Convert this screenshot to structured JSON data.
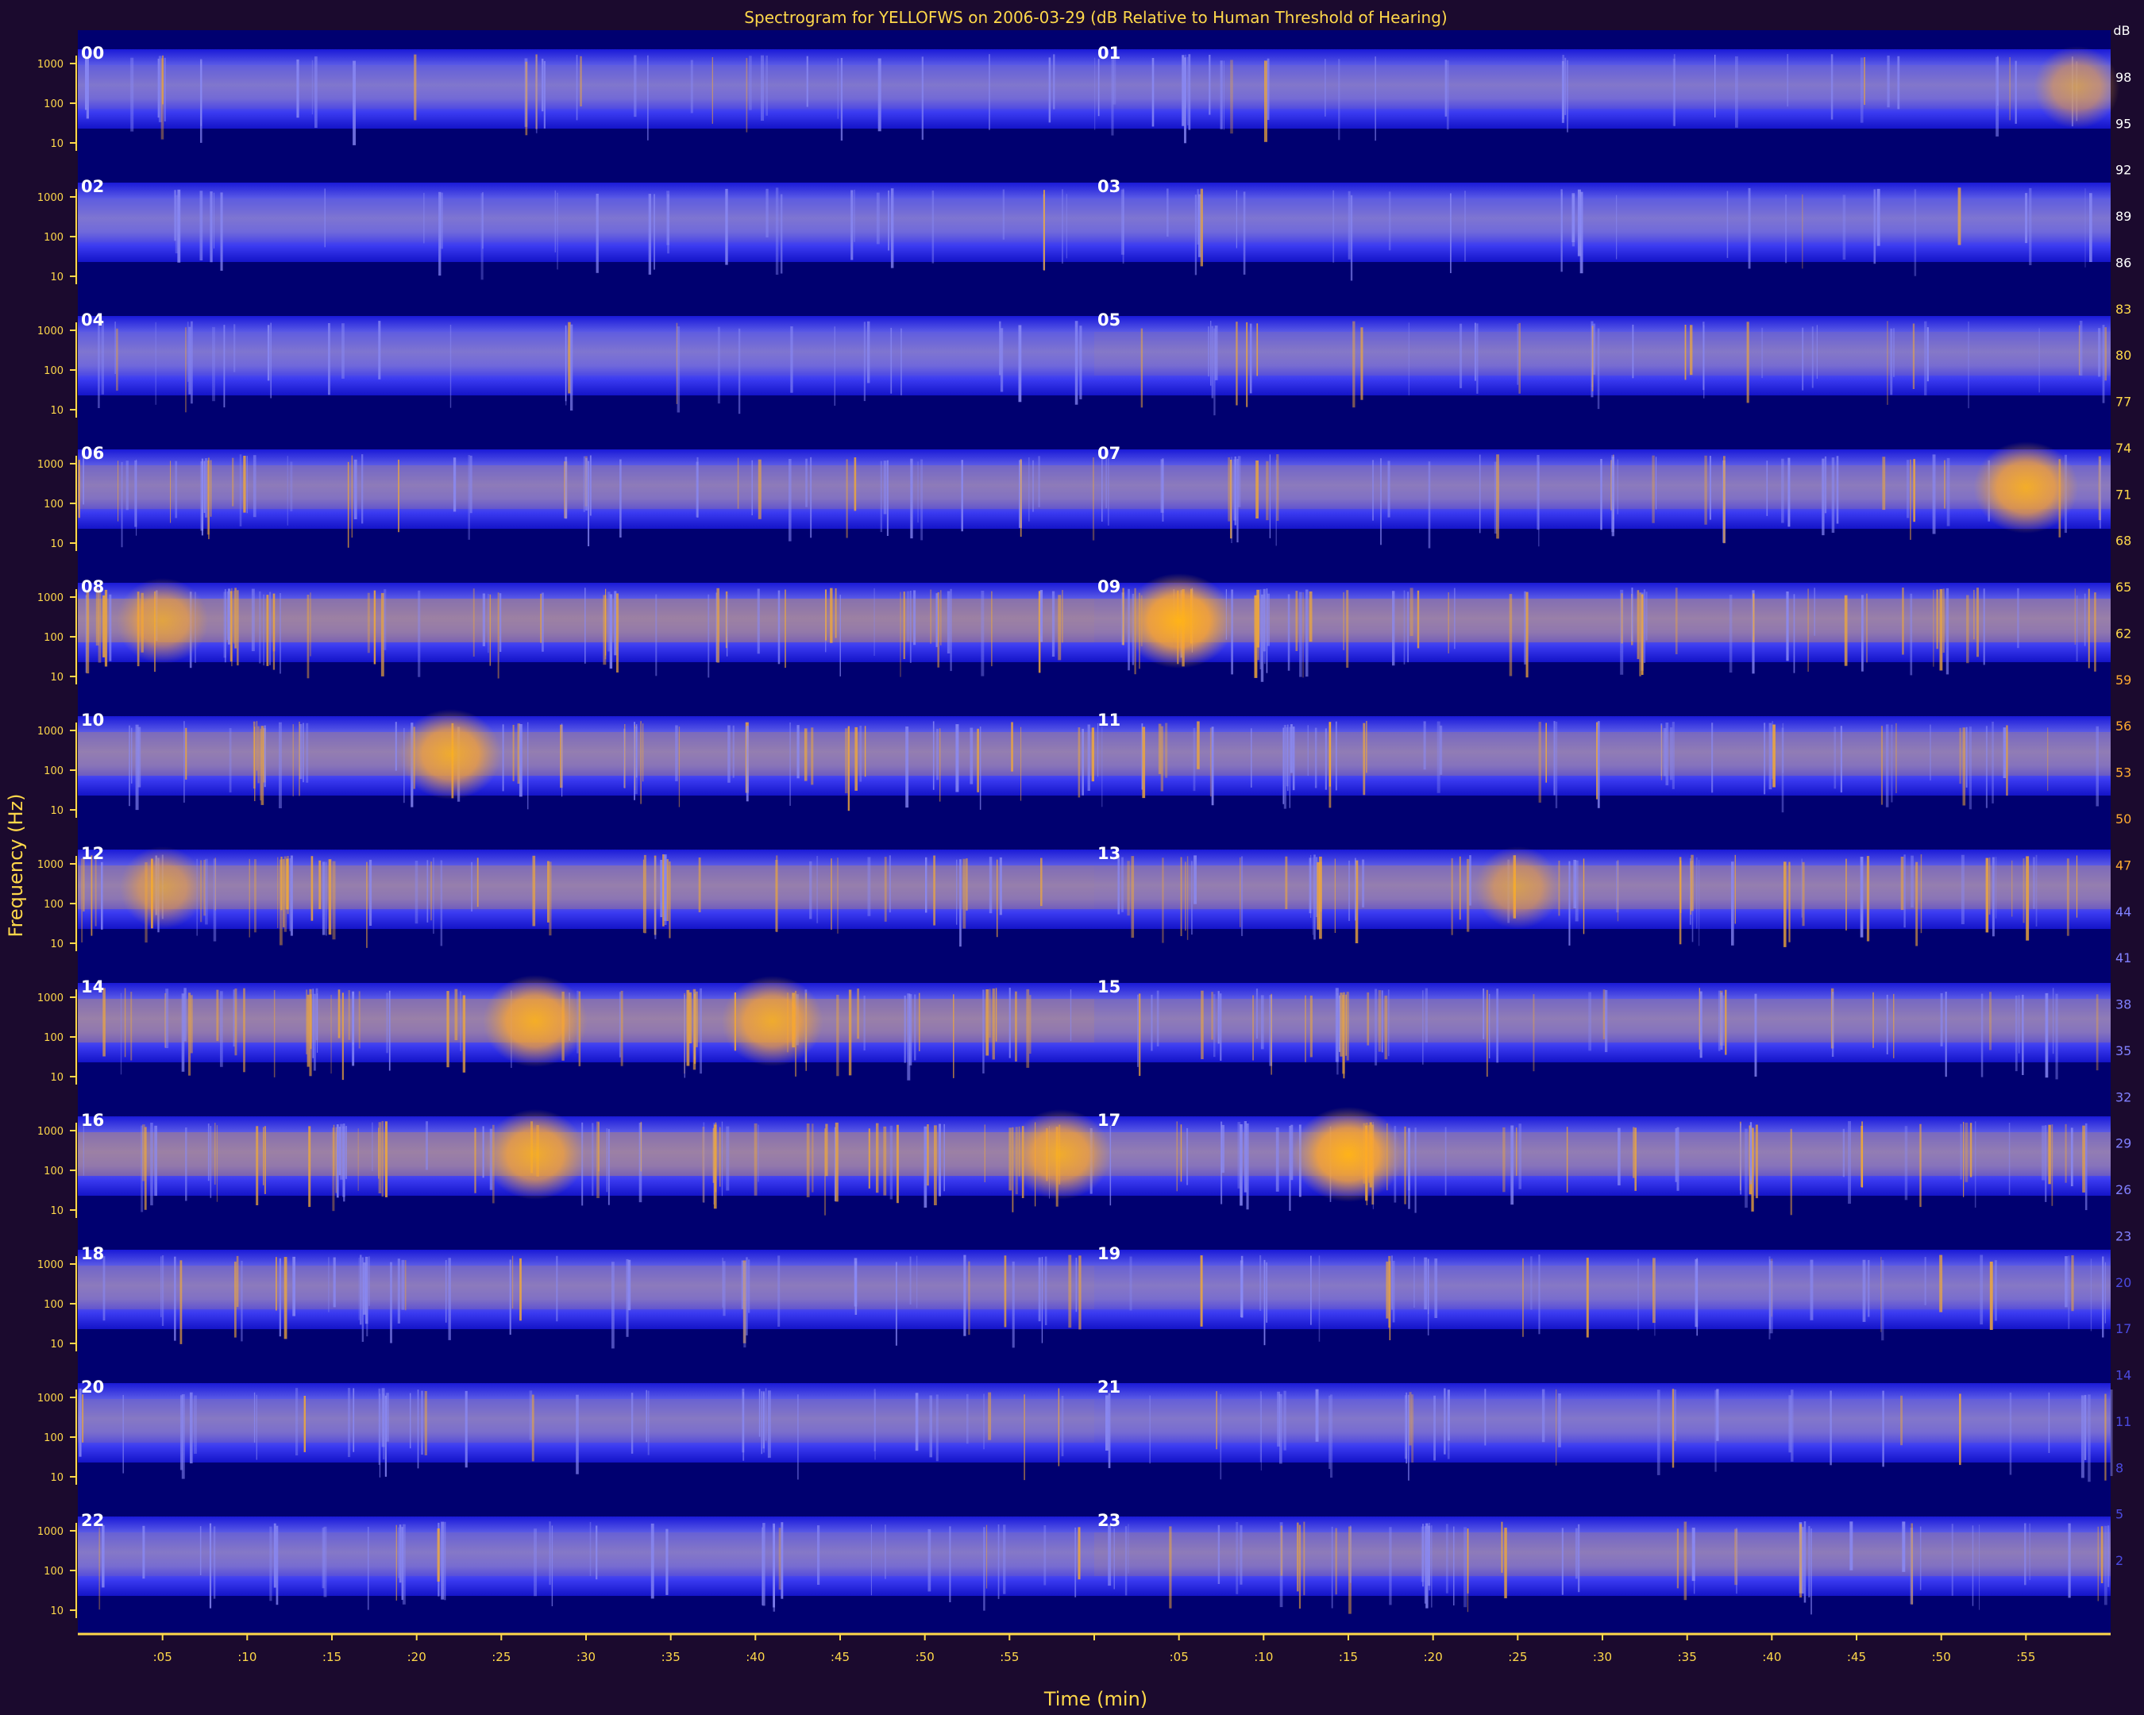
{
  "chart_data": {
    "type": "heatmap",
    "title": "Spectrogram for YELLOFWS on 2006-03-29 (dB Relative to Human Threshold of Hearing)",
    "xlabel": "Time (min)",
    "ylabel": "Frequency (Hz)",
    "colorbar_unit": "dB",
    "colorbar_ticks": [
      98,
      95,
      92,
      89,
      86,
      83,
      80,
      77,
      74,
      71,
      68,
      65,
      62,
      59,
      56,
      53,
      50,
      47,
      44,
      41,
      38,
      35,
      32,
      29,
      26,
      23,
      20,
      17,
      14,
      11,
      8,
      5,
      2
    ],
    "colorbar_range": [
      0,
      100
    ],
    "frequency_ticks": [
      "1000",
      "100",
      "10"
    ],
    "frequency_scale": "log",
    "x_tick_labels": [
      ":05",
      ":10",
      ":15",
      ":20",
      ":25",
      ":30",
      ":35",
      ":40",
      ":45",
      ":50",
      ":55",
      "",
      ":05",
      ":10",
      ":15",
      ":20",
      ":25",
      ":30",
      ":35",
      ":40",
      ":45",
      ":50",
      ":55"
    ],
    "hour_labels": [
      "00",
      "01",
      "02",
      "03",
      "04",
      "05",
      "06",
      "07",
      "08",
      "09",
      "10",
      "11",
      "12",
      "13",
      "14",
      "15",
      "16",
      "17",
      "18",
      "19",
      "20",
      "21",
      "22",
      "23"
    ],
    "hour_intensity": [
      0.1,
      0.12,
      0.05,
      0.06,
      0.08,
      0.18,
      0.35,
      0.3,
      0.62,
      0.55,
      0.45,
      0.4,
      0.5,
      0.48,
      0.55,
      0.38,
      0.6,
      0.42,
      0.3,
      0.2,
      0.22,
      0.15,
      0.18,
      0.35
    ],
    "events": [
      {
        "hour": "01",
        "minute": 58,
        "level": 0.6
      },
      {
        "hour": "07",
        "minute": 55,
        "level": 0.9
      },
      {
        "hour": "09",
        "minute": 5,
        "level": 1.0
      },
      {
        "hour": "10",
        "minute": 22,
        "level": 0.85
      },
      {
        "hour": "14",
        "minute": 27,
        "level": 0.9
      },
      {
        "hour": "14",
        "minute": 41,
        "level": 0.85
      },
      {
        "hour": "16",
        "minute": 27,
        "level": 0.85
      },
      {
        "hour": "16",
        "minute": 58,
        "level": 0.85
      },
      {
        "hour": "17",
        "minute": 15,
        "level": 1.0
      },
      {
        "hour": "13",
        "minute": 25,
        "level": 0.6
      },
      {
        "hour": "08",
        "minute": 5,
        "level": 0.7
      },
      {
        "hour": "12",
        "minute": 5,
        "level": 0.6
      }
    ]
  }
}
